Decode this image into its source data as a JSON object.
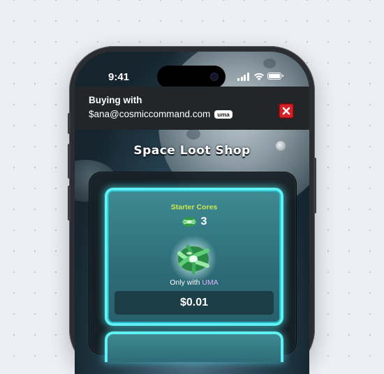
{
  "status_bar": {
    "time": "9:41"
  },
  "header": {
    "buying_label": "Buying with",
    "account": "$ana@cosmiccommand.com",
    "account_tag": "uma",
    "close_icon": "close-x"
  },
  "shop": {
    "title": "Space Loot Shop",
    "product": {
      "name": "Starter Cores",
      "quantity": "3",
      "only_with_prefix": "Only with",
      "only_with_brand": "UMA",
      "price": "$0.01"
    }
  },
  "colors": {
    "card_border": "#5ff0f4",
    "product_name": "#c9ea4a",
    "uma_brand": "#d9b2ff",
    "close_button": "#d42127"
  }
}
